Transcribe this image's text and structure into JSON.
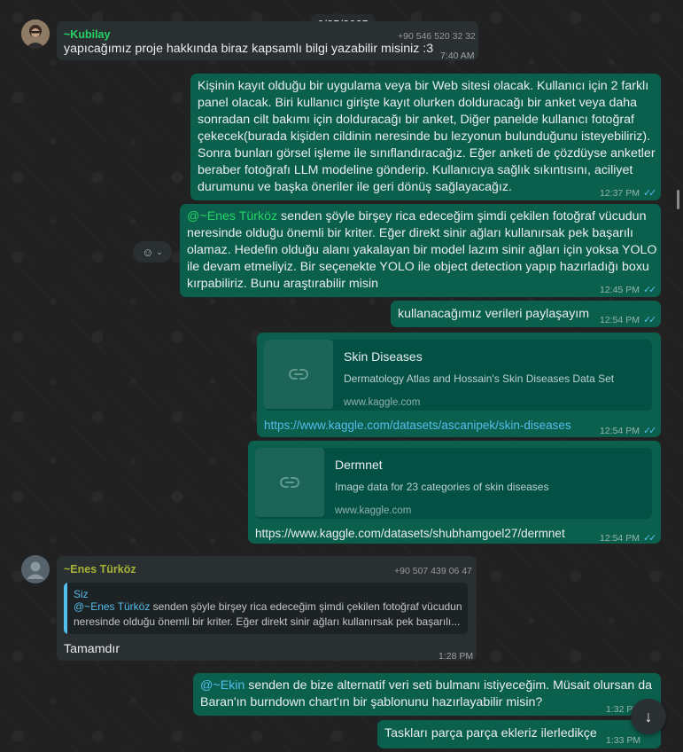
{
  "date_chip": "6/25/2025",
  "messages": {
    "m1": {
      "sender": "~Kubilay",
      "phone": "+90 546 520 32 32",
      "text": "yapıcağımız proje hakkında biraz kapsamlı bilgi yazabilir misiniz :3",
      "time": "7:40 AM"
    },
    "m2": {
      "lines": [
        "Kişinin kayıt olduğu bir uygulama veya bir Web sitesi olacak. Kullanıcı için 2 farklı",
        "panel olacak. Biri kullanıcı girişte kayıt olurken dolduracağı bir anket veya daha",
        "sonradan cilt bakımı için dolduracağı bir anket, Diğer panelde kullanıcı fotoğraf",
        "çekecek(burada kişiden cildinin neresinde bu lezyonun bulunduğunu isteyebiliriz).",
        "Sonra bunları görsel işleme ile sınıflandıracağız. Eğer anketi de çözdüyse anketler",
        "beraber fotoğrafı LLM modeline gönderip. Kullanıcıya sağlık sıkıntısını, aciliyet",
        "durumunu ve başka öneriler ile geri dönüş sağlayacağız."
      ],
      "time": "12:37 PM"
    },
    "m3": {
      "mention": "@~Enes Türköz",
      "line1_rest": " senden şöyle birşey rica edeceğim şimdi çekilen fotoğraf vücudun",
      "lines": [
        "neresinde olduğu önemli bir kriter. Eğer direkt sinir ağları kullanırsak pek başarılı",
        "olamaz. Hedefin olduğu alanı yakalayan bir model lazım sinir ağları için yoksa YOLO",
        "ile devam etmeliyiz. Bir seçenekte YOLO ile object detection yapıp hazırladığı boxu",
        "kırpabiliriz. Bunu araştırabilir misin"
      ],
      "time": "12:45 PM"
    },
    "m4": {
      "text": "kullanacağımız verileri paylaşayım",
      "time": "12:54 PM"
    },
    "m5": {
      "card_title": "Skin Diseases",
      "card_desc": "Dermatology Atlas and Hossain's Skin Diseases Data Set",
      "card_domain": "www.kaggle.com",
      "url": "https://www.kaggle.com/datasets/ascanipek/skin-diseases",
      "time": "12:54 PM"
    },
    "m6": {
      "card_title": "Dermnet",
      "card_desc": "Image data for 23 categories of skin diseases",
      "card_domain": "www.kaggle.com",
      "url": "https://www.kaggle.com/datasets/shubhamgoel27/dermnet",
      "time": "12:54 PM"
    },
    "m7": {
      "sender": "~Enes Türköz",
      "phone": "+90 507 439 06 47",
      "quote_author": "Siz",
      "quote_mention": "@~Enes Türköz",
      "quote_line1_rest": " senden şöyle birşey rica edeceğim şimdi çekilen fotoğraf vücudun",
      "quote_line2": "neresinde olduğu önemli bir kriter. Eğer direkt sinir ağları kullanırsak pek başarılı...",
      "text": "Tamamdır",
      "time": "1:28 PM"
    },
    "m8": {
      "mention": "@~Ekin",
      "line1_rest": " senden de bize alternatif veri seti bulmanı istiyeceğim. Müsait olursan da",
      "line2": "Baran'ın burndown chart'ın bir şablonunu hazırlayabilir misin?",
      "time": "1:32 PM"
    },
    "m9": {
      "text": "Taskları parça parça ekleriz ilerledikçe",
      "time": "1:33 PM"
    }
  },
  "colors": {
    "outgoing_bubble": "#0b5f4d",
    "incoming_bubble": "#2a2f32",
    "kubilay_name": "#25d366",
    "enes_name": "#a5b337",
    "mention_green": "#25d366",
    "mention_blue": "#53bdeb",
    "read_ticks": "#53bdeb"
  },
  "icons": {
    "react": "smiley-icon",
    "scroll_down": "arrow-down-icon",
    "link_thumb": "link-icon"
  }
}
